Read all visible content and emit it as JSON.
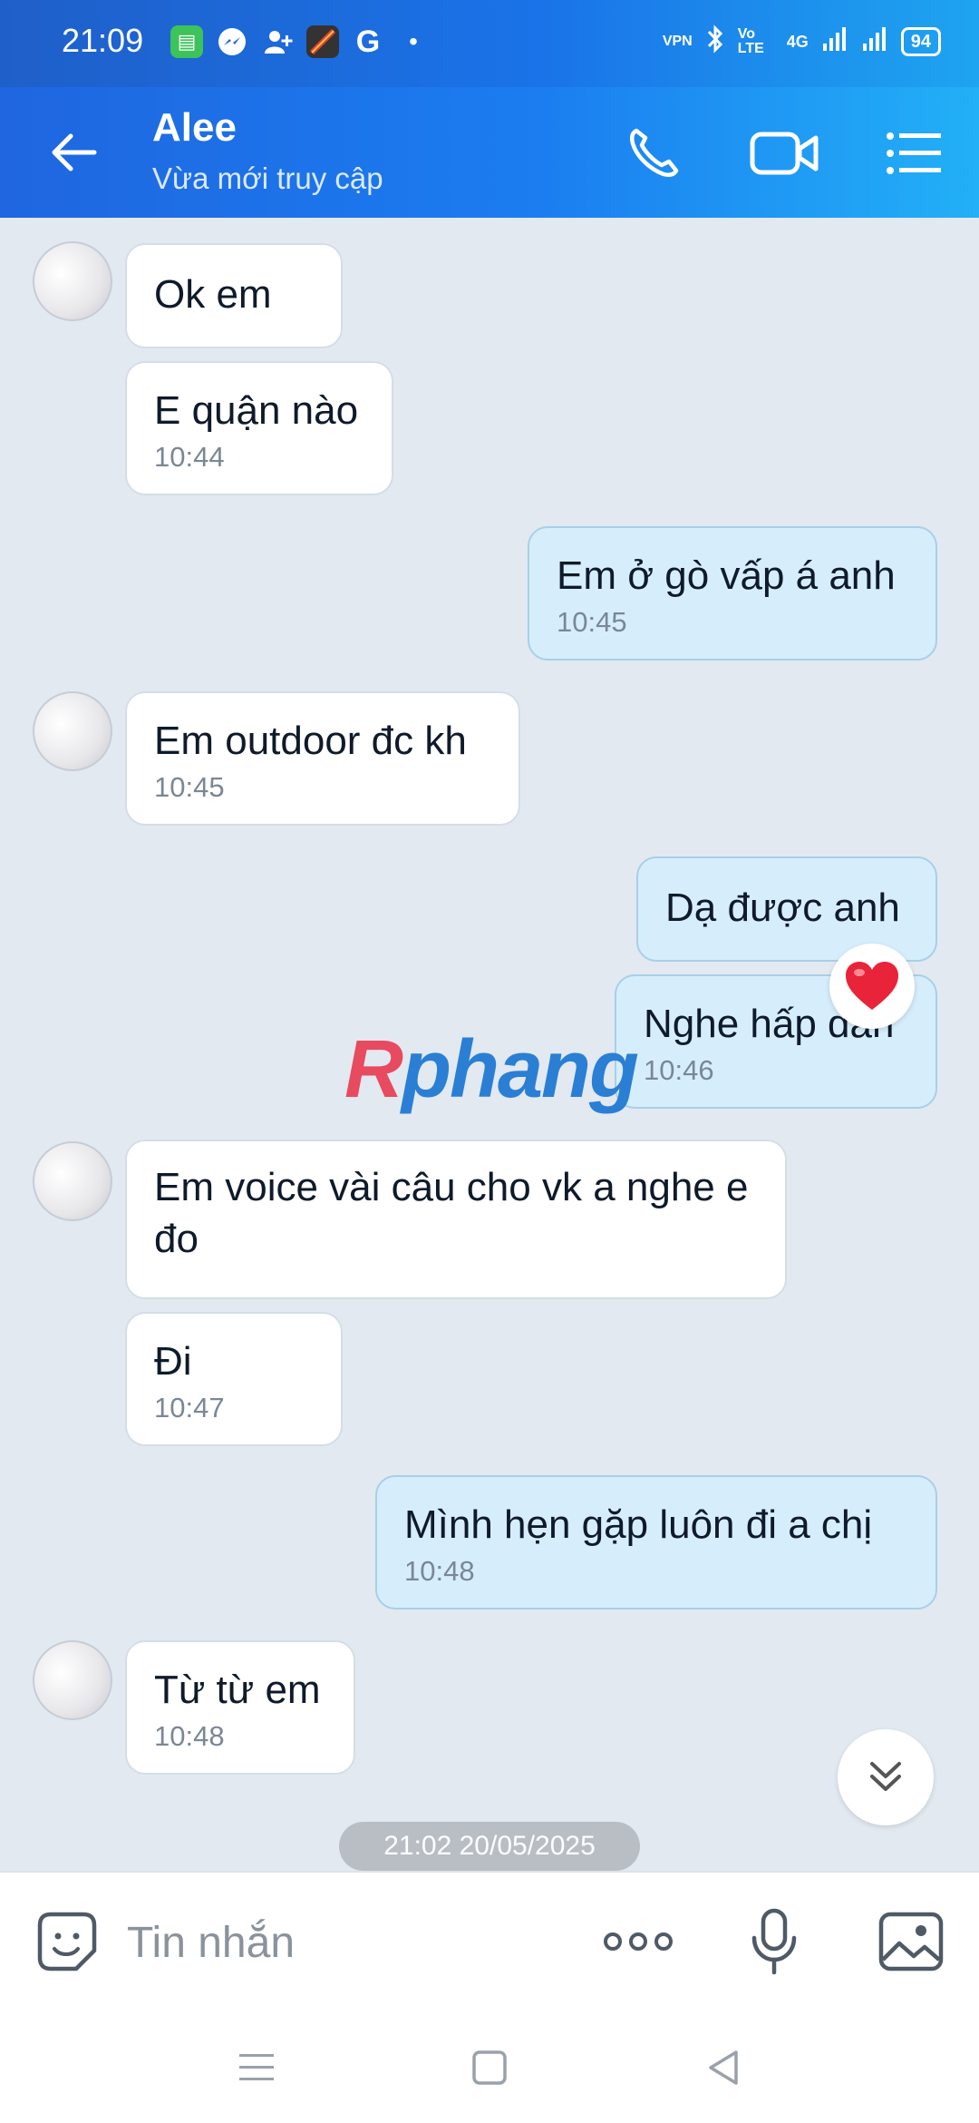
{
  "status_bar": {
    "time": "21:09",
    "battery": "94",
    "network": "4G",
    "volte": "Vo LTE",
    "vpn": "VPN"
  },
  "header": {
    "contact_name": "Alee",
    "status": "Vừa mới truy cập"
  },
  "messages": [
    {
      "side": "in",
      "text": "Ok em",
      "time": ""
    },
    {
      "side": "in",
      "text": "E quận nào",
      "time": "10:44"
    },
    {
      "side": "out",
      "text": "Em ở gò vấp á anh",
      "time": "10:45"
    },
    {
      "side": "in",
      "text": "Em outdoor đc kh",
      "time": "10:45"
    },
    {
      "side": "out",
      "text": "Dạ được anh",
      "time": ""
    },
    {
      "side": "out",
      "text": "Nghe hấp dẫn",
      "time": "10:46"
    },
    {
      "side": "in",
      "text": "Em voice vài câu cho vk a nghe e đo",
      "time": ""
    },
    {
      "side": "in",
      "text": "Đi",
      "time": "10:47"
    },
    {
      "side": "out",
      "text": "Mình hẹn gặp luôn đi a chị",
      "time": "10:48"
    },
    {
      "side": "in",
      "text": "Từ từ em",
      "time": "10:48"
    }
  ],
  "reaction": "heart-icon",
  "watermark": {
    "first": "R",
    "rest": "phang"
  },
  "date_separator": "21:02 20/05/2025",
  "input": {
    "placeholder": "Tin nhắn"
  },
  "colors": {
    "header_start": "#1f66e0",
    "header_end": "#22b0f7",
    "chat_bg": "#e2e9f1",
    "incoming_bubble": "#ffffff",
    "outgoing_bubble": "#d6eefc"
  }
}
